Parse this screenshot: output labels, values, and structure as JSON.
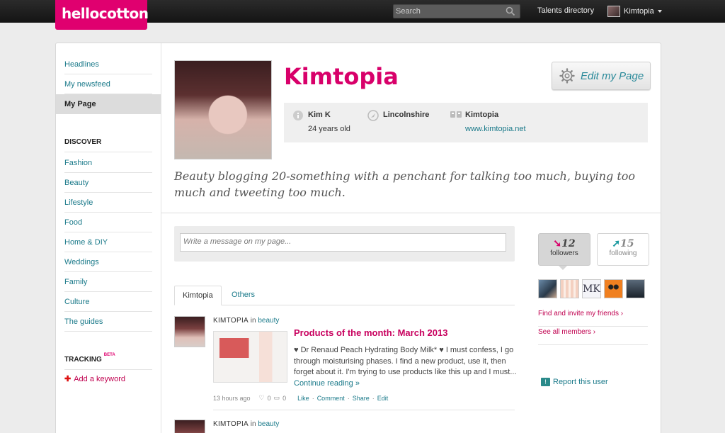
{
  "topbar": {
    "logo": "hellocotton",
    "search_placeholder": "Search",
    "talents_label": "Talents directory",
    "user_label": "Kimtopia"
  },
  "sidebar": {
    "items": [
      {
        "label": "Headlines"
      },
      {
        "label": "My newsfeed"
      },
      {
        "label": "My Page"
      }
    ],
    "discover_heading": "DISCOVER",
    "discover_items": [
      {
        "label": "Fashion"
      },
      {
        "label": "Beauty"
      },
      {
        "label": "Lifestyle"
      },
      {
        "label": "Food"
      },
      {
        "label": "Home & DIY"
      },
      {
        "label": "Weddings"
      },
      {
        "label": "Family"
      },
      {
        "label": "Culture"
      },
      {
        "label": "The guides"
      }
    ],
    "tracking_heading": "TRACKING",
    "tracking_badge": "BETA",
    "add_keyword": "Add a keyword"
  },
  "profile": {
    "name": "Kimtopia",
    "edit_label": "Edit my Page",
    "person_name": "Kim K",
    "age": "24 years old",
    "location": "Lincolnshire",
    "blog_name": "Kimtopia",
    "blog_url": "www.kimtopia.net",
    "bio": "Beauty blogging 20-something with a penchant for talking too much, buying too much and tweeting too much."
  },
  "message": {
    "placeholder": "Write a message on my page..."
  },
  "tabs": [
    {
      "label": "Kimtopia"
    },
    {
      "label": "Others"
    }
  ],
  "posts": [
    {
      "author": "KIMTOPIA",
      "in_label": "in",
      "category": "beauty",
      "title": "Products of the month: March 2013",
      "excerpt": "♥ Dr Renaud Peach Hydrating Body Milk* ♥ I must confess, I go through moisturising phases. I find a new product, use it, then forget about it. I'm trying to use products like this up and I must...",
      "continue": "Continue reading »",
      "time": "13 hours ago",
      "likes": "0",
      "comments": "0",
      "actions": [
        "Like",
        "Comment",
        "Share",
        "Edit"
      ]
    },
    {
      "author": "KIMTOPIA",
      "in_label": "in",
      "category": "beauty"
    }
  ],
  "stats": {
    "followers_count": "12",
    "followers_label": "followers",
    "following_count": "15",
    "following_label": "following"
  },
  "right": {
    "invite": "Find and invite my friends ›",
    "see_all": "See all members ›",
    "report": "Report this user"
  },
  "colors": {
    "brand": "#e0006f",
    "link": "#1b7a8a"
  }
}
